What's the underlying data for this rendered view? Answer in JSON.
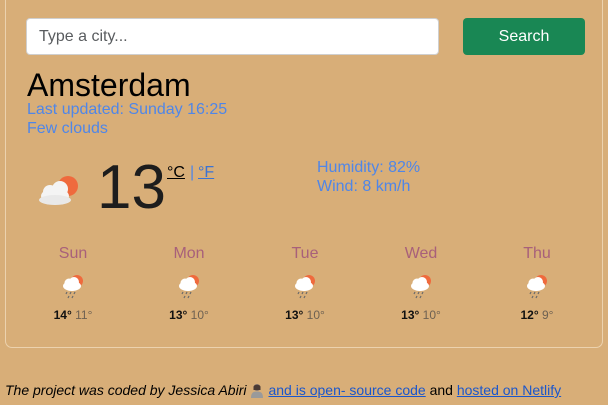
{
  "search": {
    "placeholder": "Type a city...",
    "value": "",
    "button_label": "Search"
  },
  "current": {
    "city": "Amsterdam",
    "last_updated": "Last updated: Sunday 16:25",
    "description": "Few clouds",
    "icon": "few-clouds-icon",
    "temperature": "13",
    "unit_celsius": "°C",
    "unit_separator": "|",
    "unit_fahrenheit": "°F",
    "humidity": "Humidity: 82%",
    "wind": "Wind: 8 km/h"
  },
  "forecast": [
    {
      "day": "Sun",
      "icon": "rain-icon",
      "max": "14°",
      "min": "11°"
    },
    {
      "day": "Mon",
      "icon": "rain-icon",
      "max": "13°",
      "min": "10°"
    },
    {
      "day": "Tue",
      "icon": "rain-icon",
      "max": "13°",
      "min": "10°"
    },
    {
      "day": "Wed",
      "icon": "rain-icon",
      "max": "13°",
      "min": "10°"
    },
    {
      "day": "Thu",
      "icon": "rain-icon",
      "max": "12°",
      "min": "9°"
    }
  ],
  "footer": {
    "prefix": "The project was coded by Jessica Abiri",
    "avatar_icon": "person-avatar-icon",
    "github_link": "and is open- source code",
    "middle": "and",
    "netlify_link": "hosted on Netlify"
  },
  "colors": {
    "background": "#d8ae78",
    "search_button": "#198754",
    "accent_text": "#4f86e8",
    "day_name": "#a8607a"
  }
}
